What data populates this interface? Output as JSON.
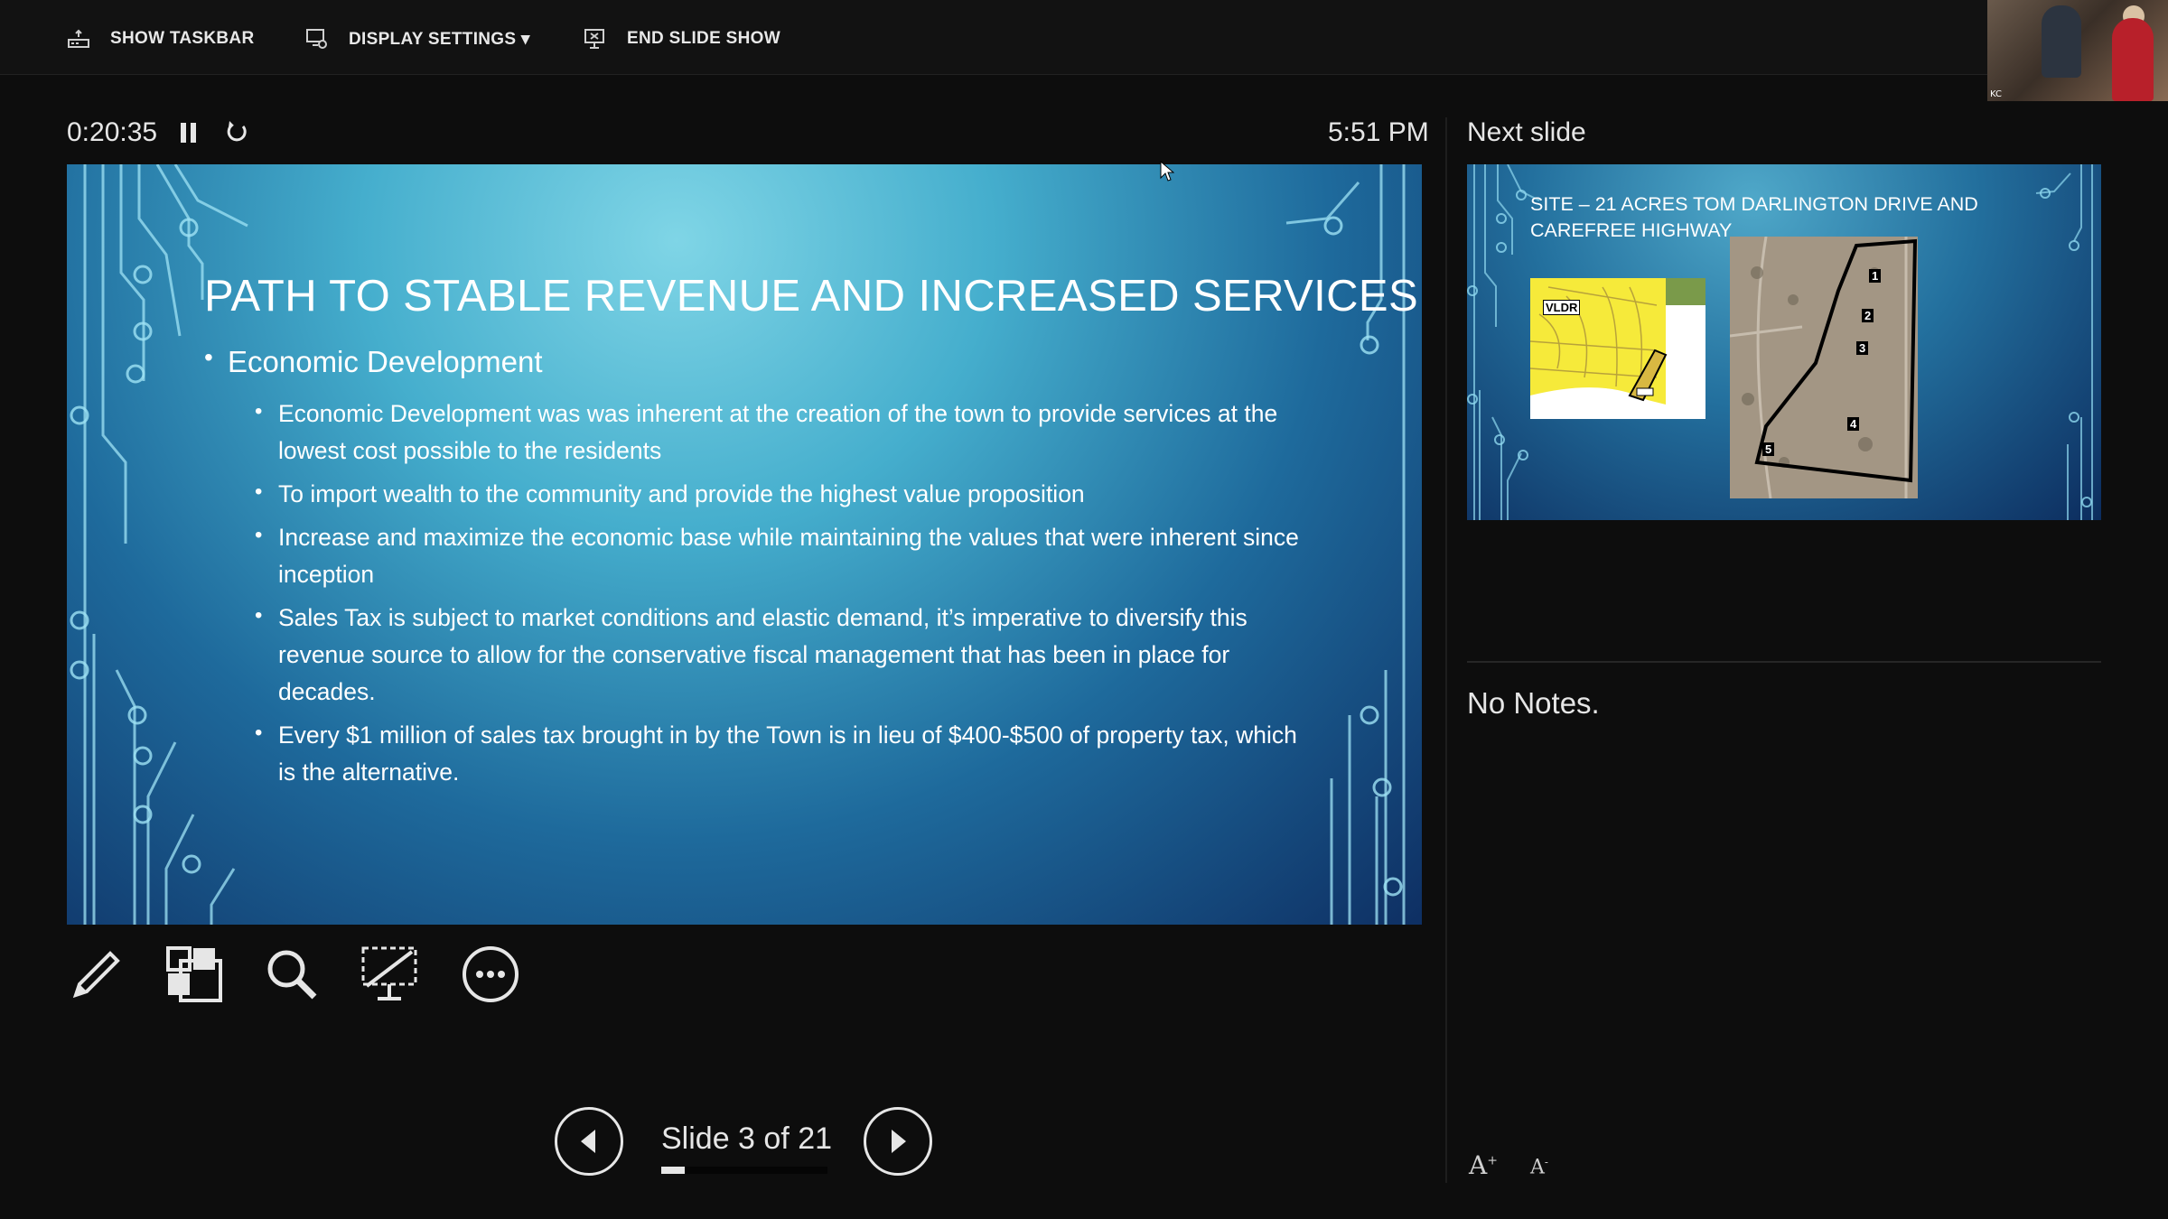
{
  "toolbar": {
    "show_taskbar": "SHOW TASKBAR",
    "display_settings": "DISPLAY SETTINGS ▾",
    "end_slide_show": "END SLIDE SHOW"
  },
  "presenter": {
    "timer": "0:20:35",
    "clock": "5:51 PM",
    "next_slide_label": "Next slide",
    "notes": "No Notes."
  },
  "current_slide": {
    "title": "PATH TO STABLE REVENUE AND INCREASED SERVICES",
    "bullet": "Economic Development",
    "sub_bullets": [
      "Economic Development was was inherent at the creation of the town to provide services at the lowest cost possible to the residents",
      "To import wealth to the community and provide the highest value proposition",
      "Increase and maximize the economic base while maintaining the values that were inherent since inception",
      " Sales Tax is subject to market conditions and elastic demand, it’s imperative to diversify this revenue source to allow for the conservative fiscal management that has been in place for decades.",
      "Every $1 million of sales tax brought in by the Town is in lieu of $400-$500 of property tax, which is the alternative."
    ]
  },
  "next_slide": {
    "title": "SITE – 21 ACRES TOM DARLINGTON DRIVE AND CAREFREE HIGHWAY",
    "map_label": "VLDR",
    "parcel_numbers": [
      "1",
      "2",
      "3",
      "4",
      "5"
    ]
  },
  "navigation": {
    "slide_counter": "Slide 3 of 21",
    "current": 3,
    "total": 21
  },
  "video_thumbnail": {
    "tag": "KC"
  },
  "font_controls": {
    "increase": "A",
    "decrease": "A"
  },
  "colors": {
    "background": "#0d0d0d",
    "slide_gradient_light": "#7fd5e6",
    "slide_gradient_dark": "#0e2f63",
    "text": "#e6e6e6"
  }
}
